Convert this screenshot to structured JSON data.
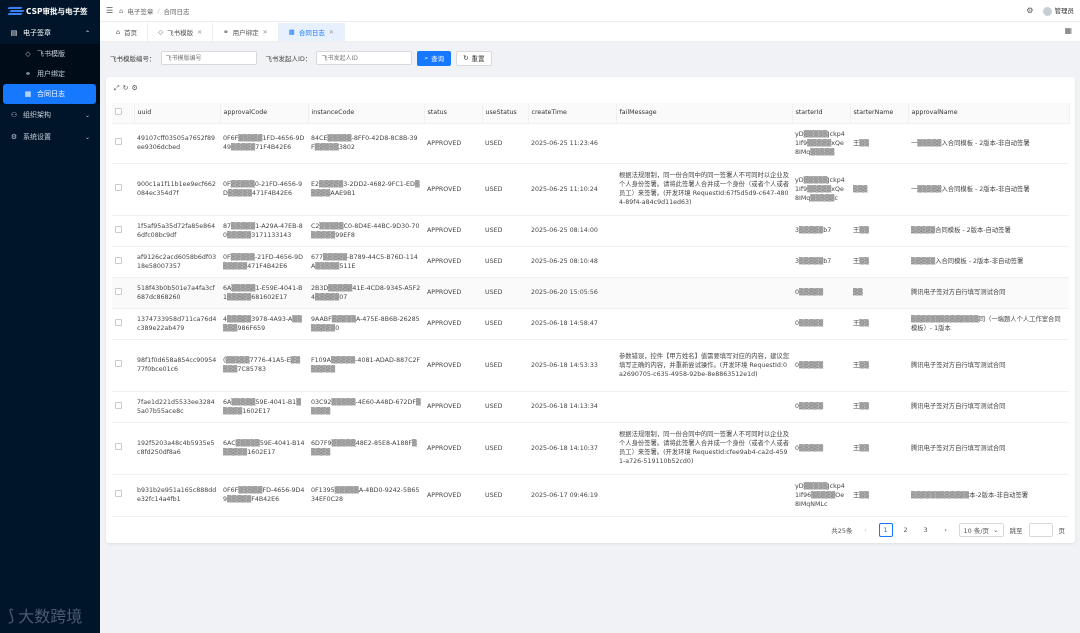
{
  "app": {
    "name": "CSP审批与电子签"
  },
  "sidebar": {
    "groups": [
      {
        "label": "电子签章",
        "open": true,
        "items": [
          {
            "label": "飞书模版",
            "active": false
          },
          {
            "label": "用户绑定",
            "active": false
          },
          {
            "label": "合同日志",
            "active": true
          }
        ]
      },
      {
        "label": "组织架构",
        "open": false,
        "items": []
      },
      {
        "label": "系统设置",
        "open": false,
        "items": []
      }
    ],
    "brand": "大数跨境"
  },
  "header": {
    "breadcrumb": [
      "电子签章",
      "合同日志"
    ],
    "user": "管理员"
  },
  "tabs": [
    {
      "label": "首页",
      "icon": "home-icon",
      "closable": false,
      "active": false
    },
    {
      "label": "飞书模版",
      "icon": "tag-icon",
      "closable": true,
      "active": false
    },
    {
      "label": "用户绑定",
      "icon": "user-link-icon",
      "closable": true,
      "active": false
    },
    {
      "label": "合同日志",
      "icon": "grid-icon",
      "closable": true,
      "active": true
    }
  ],
  "search": {
    "field1_label": "飞书模版编号：",
    "field1_placeholder": "飞书模版编号",
    "field2_label": "飞书发起人ID：",
    "field2_placeholder": "飞书发起人ID",
    "search_btn": "查询",
    "reset_btn": "重置"
  },
  "table": {
    "columns": [
      "uuid",
      "approvalCode",
      "instanceCode",
      "status",
      "useStatus",
      "createTime",
      "failMessage",
      "starterId",
      "starterName",
      "approvalName"
    ],
    "rows": [
      {
        "uuid": "49107cff03505a7652f89ee9306dcbed",
        "approvalCode": "0F6F▒▒▒▒▒1FD-4656-9D49▒▒▒▒▒71F4B42E6",
        "instanceCode": "84CE▒▒▒▒▒-8FF0-42D8-8C8B-39F▒▒▒▒▒3802",
        "status": "APPROVED",
        "useStatus": "USED",
        "createTime": "2025-06-25 11:23:46",
        "failMessage": "",
        "starterId": "yD▒▒▒▒▒Jckp41If9▒▒▒▒▒xQe8IMq▒▒▒▒▒",
        "starterName": "王▒▒",
        "approvalName": "一▒▒▒▒▒入合同模板 - 2版本-非自动签署"
      },
      {
        "uuid": "900c1a1f11b1ee9ecf662084ec354d7f",
        "approvalCode": "0F▒▒▒▒▒0-21FD-4656-9D▒▒▒▒▒471F4B42E6",
        "instanceCode": "E2▒▒▒▒▒3-2DD2-4682-9FC1-ED▒▒▒▒▒AAE9B1",
        "status": "APPROVED",
        "useStatus": "USED",
        "createTime": "2025-06-25 11:10:24",
        "failMessage": "根据法规限制，同一份合同中的同一签署人不可同时以企业及个人身份签署。请将此签署人合并成一个身份（或者个人或者员工）来签署。(开发环境 RequestId:67f5d5d9-c647-4804-89f4-a84c9d11ed63)",
        "starterId": "yD▒▒▒▒▒Jckp41If9▒▒▒▒▒xQe8IMq▒▒▒▒▒c",
        "starterName": "▒▒▒",
        "approvalName": "一▒▒▒▒▒入合同模板 - 2版本-非自动签署"
      },
      {
        "uuid": "1f5af95a35d72fa85e8646dfc08bc9df",
        "approvalCode": "87▒▒▒▒▒1-A29A-47EB-80▒▒▒▒▒3171133143",
        "instanceCode": "C2▒▒▒▒▒C0-8D4E-44BC-9D30-70▒▒▒▒▒99EF8",
        "status": "APPROVED",
        "useStatus": "USED",
        "createTime": "2025-06-25 08:14:00",
        "failMessage": "",
        "starterId": "3▒▒▒▒▒b7",
        "starterName": "王▒▒",
        "approvalName": "▒▒▒▒▒合同模板 - 2版本-自动签署"
      },
      {
        "uuid": "af9126c2acd6058b6df0318e58007357",
        "approvalCode": "0F▒▒▒▒▒-21FD-4656-9D▒▒▒▒▒471F4B42E6",
        "instanceCode": "677▒▒▒▒▒-B789-44C5-B76D-114A▒▒▒▒▒511E",
        "status": "APPROVED",
        "useStatus": "USED",
        "createTime": "2025-06-25 08:10:48",
        "failMessage": "",
        "starterId": "3▒▒▒▒▒b7",
        "starterName": "王▒▒",
        "approvalName": "▒▒▒▒▒入合同模板 - 2版本-非自动签署"
      },
      {
        "uuid": "518f43b0b501e7a4fa3cf687dc868260",
        "approvalCode": "6A▒▒▒▒▒1-E59E-4041-B1▒▒▒▒▒681602E17",
        "instanceCode": "2B3D▒▒▒▒▒41E-4CD8-9345-A5F24▒▒▒▒▒07",
        "status": "APPROVED",
        "useStatus": "USED",
        "createTime": "2025-06-20 15:05:56",
        "failMessage": "",
        "starterId": "0▒▒▒▒▒",
        "starterName": "▒▒",
        "approvalName": "腾讯电子签对方自行填写测试合同"
      },
      {
        "uuid": "1374733958d711ca76d4c389e22ab479",
        "approvalCode": "4▒▒▒▒▒3978-4A93-A▒▒▒▒▒986F659",
        "instanceCode": "9AABF▒▒▒▒▒A-475E-8B6B-26285▒▒▒▒▒0",
        "status": "APPROVED",
        "useStatus": "USED",
        "createTime": "2025-06-18 14:58:47",
        "failMessage": "",
        "starterId": "0▒▒▒▒▒",
        "starterName": "王▒▒",
        "approvalName": "▒▒▒▒▒▒▒▒▒▒▒▒▒▒同（一端题人个人工作室合同模板）- 1版本"
      },
      {
        "uuid": "98f1f0d658a854cc9095477f0bce01c6",
        "approvalCode": "(▒▒▒▒▒7776-41A5-E▒▒▒▒▒7C85783",
        "instanceCode": "F109A▒▒▒▒▒-4081-ADAD-887C2F▒▒▒▒▒",
        "status": "APPROVED",
        "useStatus": "USED",
        "createTime": "2025-06-18 14:53:33",
        "failMessage": "参数错误，控件【甲方姓名】值需要填写对应的内容，建议您填写正确的内容，并重新尝试操作。(开发环境 RequestId:0a2690705-c635-4958-92be-8e8863512e1d)",
        "starterId": "0▒▒▒▒▒",
        "starterName": "王▒▒",
        "approvalName": "腾讯电子签对方自行填写测试合同"
      },
      {
        "uuid": "7fae1d221d5533ee32845a07b55ace8c",
        "approvalCode": "6A▒▒▒▒▒59E-4041-B1▒▒▒▒▒1602E17",
        "instanceCode": "03C92▒▒▒▒▒-4E60-A48D-672DF▒▒▒▒▒",
        "status": "APPROVED",
        "useStatus": "USED",
        "createTime": "2025-06-18 14:13:34",
        "failMessage": "",
        "starterId": "0▒▒▒▒▒",
        "starterName": "王▒▒",
        "approvalName": "腾讯电子签对方自行填写测试合同"
      },
      {
        "uuid": "192f5203a48c4b5935e5c8fd250df8a6",
        "approvalCode": "6AC▒▒▒▒▒59E-4041-B14▒▒▒▒▒1602E17",
        "instanceCode": "6D7F9▒▒▒▒▒48E2-85E8-A188F▒▒▒▒▒",
        "status": "APPROVED",
        "useStatus": "USED",
        "createTime": "2025-06-18 14:10:37",
        "failMessage": "根据法规限制，同一份合同中的同一签署人不可同时以企业及个人身份签署。请将此签署人合并成一个身份（或者个人或者员工）来签署。(开发环境 RequestId:cfee9ab4-ca2d-4591-a726-519110b52cd0)",
        "starterId": "0▒▒▒▒▒",
        "starterName": "王▒▒",
        "approvalName": "腾讯电子签对方自行填写测试合同"
      },
      {
        "uuid": "b931b2e951a165c888dde32fc14a4fb1",
        "approvalCode": "0F6F▒▒▒▒▒FD-4656-9D49▒▒▒▒▒F4B42E6",
        "instanceCode": "0F1395▒▒▒▒▒A-4BD0-9242-5B6534EF0C28",
        "status": "APPROVED",
        "useStatus": "USED",
        "createTime": "2025-06-17 09:46:19",
        "failMessage": "",
        "starterId": "yD▒▒▒▒▒Jckp41If96▒▒▒▒▒Oe8IMqNMLc",
        "starterName": "王▒▒",
        "approvalName": "▒▒▒▒▒▒▒▒▒▒▒▒本-2版本-非自动签署"
      }
    ]
  },
  "pagination": {
    "total_text": "共25条",
    "pages": [
      "1",
      "2",
      "3"
    ],
    "current": "1",
    "page_size": "10 条/页",
    "jump_label": "跳至",
    "page_suffix": "页"
  }
}
